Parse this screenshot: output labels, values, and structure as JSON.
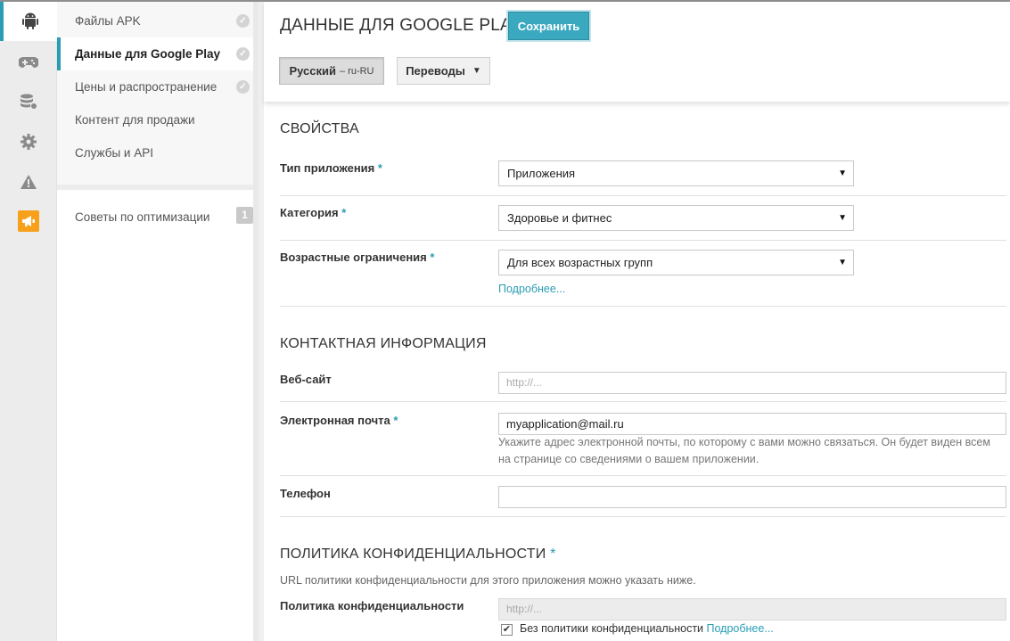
{
  "rail": {
    "items": [
      {
        "name": "android-icon",
        "active": true
      },
      {
        "name": "gamepad-icon",
        "active": false
      },
      {
        "name": "database-icon",
        "active": false
      },
      {
        "name": "gear-icon",
        "active": false
      },
      {
        "name": "warning-icon",
        "active": false
      },
      {
        "name": "megaphone-icon",
        "active": false
      }
    ]
  },
  "submenu": {
    "items": [
      {
        "label": "Файлы APK",
        "checked": true
      },
      {
        "label": "Данные для Google Play",
        "checked": true,
        "active": true
      },
      {
        "label": "Цены и распространение",
        "checked": true
      },
      {
        "label": "Контент для продажи",
        "checked": false
      },
      {
        "label": "Службы и API",
        "checked": false
      }
    ],
    "tips_label": "Советы по оптимизации",
    "tips_count": "1"
  },
  "header": {
    "title": "ДАННЫЕ ДЛЯ GOOGLE PLAY",
    "save_label": "Сохранить",
    "language_label": "Русский",
    "language_code": "– ru-RU",
    "translations_label": "Переводы",
    "translations_arrow": "▼"
  },
  "properties": {
    "title": "СВОЙСТВА",
    "app_type_label": "Тип приложения",
    "app_type_value": "Приложения",
    "category_label": "Категория",
    "category_value": "Здоровье и фитнес",
    "rating_label": "Возрастные ограничения",
    "rating_value": "Для всех возрастных групп",
    "more_link": "Подробнее...",
    "required_mark": "*",
    "caret": "▼"
  },
  "contact": {
    "title": "КОНТАКТНАЯ ИНФОРМАЦИЯ",
    "website_label": "Веб-сайт",
    "website_placeholder": "http://...",
    "email_label": "Электронная почта",
    "email_value": "myapplication@mail.ru",
    "email_help": "Укажите адрес электронной почты, по которому с вами можно связаться. Он будет виден всем на странице со сведениями о вашем приложении.",
    "phone_label": "Телефон",
    "phone_value": ""
  },
  "privacy": {
    "title": "ПОЛИТИКА КОНФИДЕНЦИАЛЬНОСТИ",
    "note": "URL политики конфиденциальности для этого приложения можно указать ниже.",
    "policy_label": "Политика конфиденциальности",
    "policy_placeholder": "http://...",
    "no_policy_label": "Без политики конфиденциальности",
    "no_policy_checked": true,
    "more_link": "Подробнее..."
  },
  "colors": {
    "accent": "#2a9db3",
    "save_button": "#3aa8bf",
    "alert_icon_bg": "#f6a01c"
  }
}
